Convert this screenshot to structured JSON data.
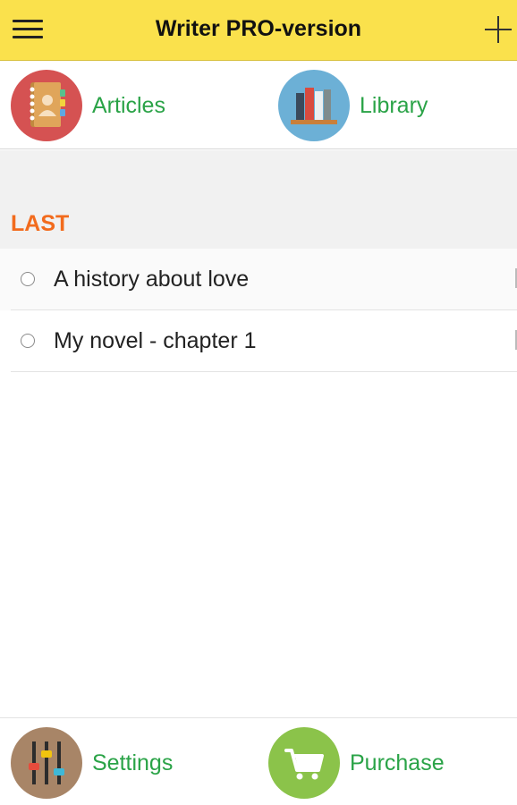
{
  "appbar": {
    "title": "Writer PRO-version",
    "menu_icon": "hamburger-menu-icon",
    "add_icon": "plus-icon"
  },
  "topnav": {
    "articles": {
      "label": "Articles",
      "icon": "address-book-icon",
      "circle_color": "#d55252"
    },
    "library": {
      "label": "Library",
      "icon": "books-on-shelf-icon",
      "circle_color": "#6cb0d6"
    }
  },
  "section": {
    "title": "LAST",
    "color": "#f26b1d"
  },
  "items": [
    {
      "label": "A history about love"
    },
    {
      "label": "My novel - chapter 1"
    }
  ],
  "bottomnav": {
    "settings": {
      "label": "Settings",
      "icon": "equalizer-sliders-icon",
      "circle_color": "#a88567"
    },
    "purchase": {
      "label": "Purchase",
      "icon": "shopping-cart-icon",
      "circle_color": "#8bc34a"
    }
  },
  "colors": {
    "appbar": "#fae14c",
    "nav_label": "#2aa347"
  }
}
